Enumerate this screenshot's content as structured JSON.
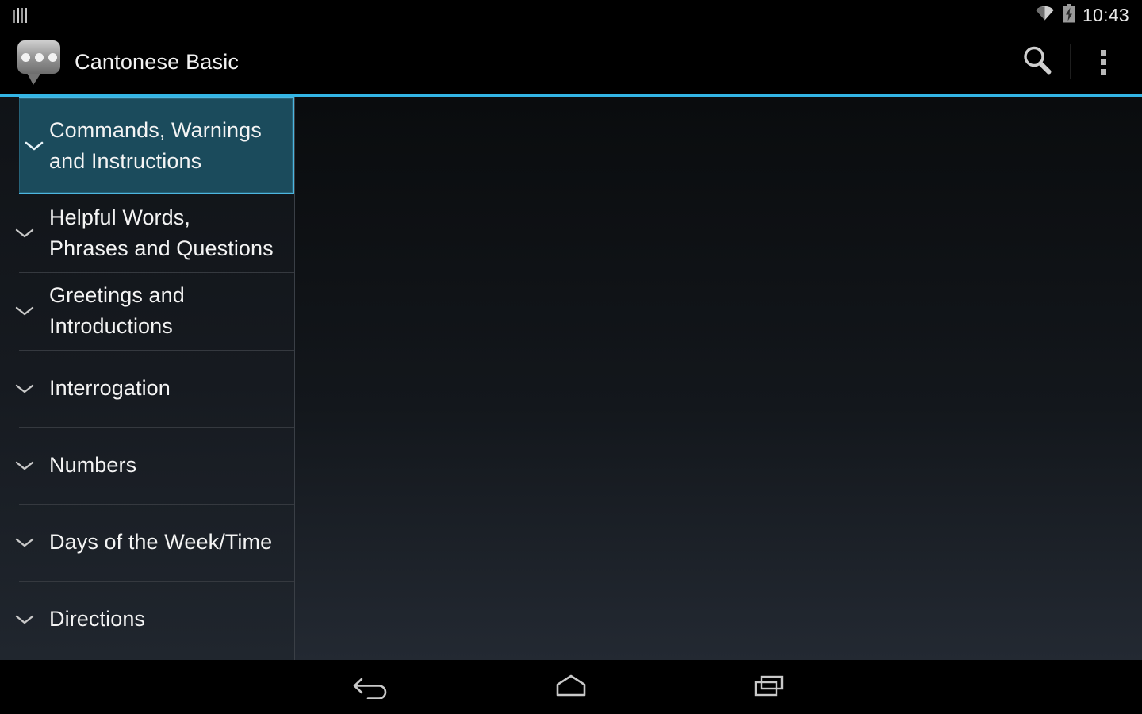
{
  "status_bar": {
    "notification_icon": "signal-bars-icon",
    "wifi_icon": "wifi-icon",
    "battery_icon": "battery-charging-icon",
    "time": "10:43"
  },
  "action_bar": {
    "app_icon": "speech-bubble-icon",
    "title": "Cantonese Basic",
    "search_icon": "search-icon",
    "overflow_icon": "overflow-menu-icon"
  },
  "theme": {
    "accent": "#33b5e5",
    "selected_bg": "#1b4b5c",
    "selected_border": "#4cb6e0",
    "sidebar_bg": "#161a20",
    "text": "#f4f4f4",
    "divider": "#35393f"
  },
  "sidebar": {
    "items": [
      {
        "label": "Commands, Warnings and Instructions",
        "expand_icon": "chevron-down-icon",
        "selected": true
      },
      {
        "label": "Helpful Words, Phrases and Questions",
        "expand_icon": "chevron-down-icon",
        "selected": false
      },
      {
        "label": "Greetings and Introductions",
        "expand_icon": "chevron-down-icon",
        "selected": false
      },
      {
        "label": "Interrogation",
        "expand_icon": "chevron-down-icon",
        "selected": false
      },
      {
        "label": "Numbers",
        "expand_icon": "chevron-down-icon",
        "selected": false
      },
      {
        "label": "Days of the Week/Time",
        "expand_icon": "chevron-down-icon",
        "selected": false
      },
      {
        "label": "Directions",
        "expand_icon": "chevron-down-icon",
        "selected": false
      }
    ]
  },
  "main_pane": {
    "content": ""
  },
  "navigation_bar": {
    "back_icon": "back-arrow-icon",
    "home_icon": "home-icon",
    "recents_icon": "recent-apps-icon"
  }
}
